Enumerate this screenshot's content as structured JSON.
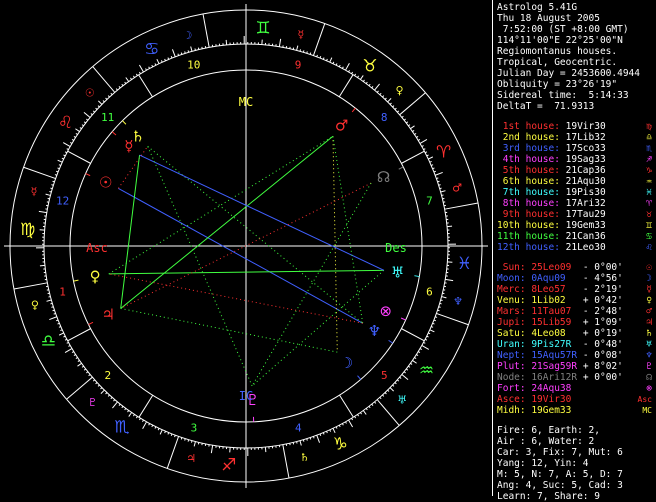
{
  "header": [
    "Astrolog 5.41G",
    "Thu 18 August 2005",
    " 7:52:00 (ST +8:00 GMT)",
    "114°11'00\"E 22°25'00\"N",
    "Regiomontanus houses.",
    "Tropical, Geocentric.",
    "Julian Day = 2453600.4944",
    "Obliquity = 23°26'19\"",
    "Sidereal time:  5:14:33",
    "DeltaT =  71.9313"
  ],
  "houses": [
    {
      "label": "1st house:",
      "value": "19Vir30",
      "color": "#ff3030",
      "glyph": "♍"
    },
    {
      "label": "2nd house:",
      "value": "17Lib32",
      "color": "#ffff40",
      "glyph": "♎"
    },
    {
      "label": "3rd house:",
      "value": "17Sco33",
      "color": "#4060ff",
      "glyph": "♏"
    },
    {
      "label": "4th house:",
      "value": "19Sag33",
      "color": "#ff40ff",
      "glyph": "♐"
    },
    {
      "label": "5th house:",
      "value": "21Cap36",
      "color": "#ff3030",
      "glyph": "♑"
    },
    {
      "label": "6th house:",
      "value": "21Aqu30",
      "color": "#ffff40",
      "glyph": "♒"
    },
    {
      "label": "7th house:",
      "value": "19Pis30",
      "color": "#40ffff",
      "glyph": "♓"
    },
    {
      "label": "8th house:",
      "value": "17Ari32",
      "color": "#ff40ff",
      "glyph": "♈"
    },
    {
      "label": "9th house:",
      "value": "17Tau29",
      "color": "#ff3030",
      "glyph": "♉"
    },
    {
      "label": "10th house:",
      "value": "19Gem33",
      "color": "#ffff40",
      "glyph": "♊"
    },
    {
      "label": "11th house:",
      "value": "21Can36",
      "color": "#40ff40",
      "glyph": "♋"
    },
    {
      "label": "12th house:",
      "value": "21Leo30",
      "color": "#4060ff",
      "glyph": "♌"
    }
  ],
  "planets": [
    {
      "name": "Sun:",
      "pos": "25Leo09",
      "motion": "- 0°00'",
      "color": "#ff3030",
      "glyph": "☉"
    },
    {
      "name": "Moon:",
      "pos": "0Aqu09",
      "motion": "- 4°56'",
      "color": "#4060ff",
      "glyph": "☽"
    },
    {
      "name": "Merc:",
      "pos": "8Leo57",
      "motion": "- 2°19'",
      "color": "#ff3030",
      "glyph": "☿"
    },
    {
      "name": "Venu:",
      "pos": "1Lib02",
      "motion": "+ 0°42'",
      "color": "#ffff40",
      "glyph": "♀"
    },
    {
      "name": "Mars:",
      "pos": "11Tau07",
      "motion": "- 2°48'",
      "color": "#ff3030",
      "glyph": "♂"
    },
    {
      "name": "Jupi:",
      "pos": "15Lib59",
      "motion": "+ 1°09'",
      "color": "#ff3030",
      "glyph": "♃"
    },
    {
      "name": "Satu:",
      "pos": "4Leo08",
      "motion": "+ 0°19'",
      "color": "#ffff40",
      "glyph": "♄"
    },
    {
      "name": "Uran:",
      "pos": "9Pis27R",
      "motion": "- 0°48'",
      "color": "#40ffff",
      "glyph": "♅"
    },
    {
      "name": "Nept:",
      "pos": "15Aqu57R",
      "motion": "- 0°08'",
      "color": "#4060ff",
      "glyph": "♆"
    },
    {
      "name": "Plut:",
      "pos": "21Sag59R",
      "motion": "+ 8°02'",
      "color": "#ff40ff",
      "glyph": "♇"
    },
    {
      "name": "Node:",
      "pos": "16Ari12R",
      "motion": "+ 0°00'",
      "color": "#808080",
      "glyph": "☊"
    },
    {
      "name": "Fort:",
      "pos": "24Aqu38",
      "motion": "",
      "color": "#ff40ff",
      "glyph": "⊗"
    },
    {
      "name": "Asce:",
      "pos": "19Vir30",
      "motion": "",
      "color": "#ff3030",
      "glyph": "Asc"
    },
    {
      "name": "Midh:",
      "pos": "19Gem33",
      "motion": "",
      "color": "#ffff40",
      "glyph": "MC"
    }
  ],
  "summary": [
    "Fire: 6, Earth: 2,",
    "Air : 6, Water: 2",
    "Car: 3, Fix: 7, Mut: 6",
    "Yang: 12, Yin: 4",
    "M: 5, N: 7, A: 5, D: 7",
    "Ang: 4, Suc: 5, Cad: 3",
    "Learn: 7, Share: 9"
  ],
  "wheel": {
    "asc_label": "Asc",
    "des_label": "Des",
    "mc_label": "MC",
    "ic_label": "IC",
    "signs": [
      {
        "glyph": "♈",
        "color": "#ff3030"
      },
      {
        "glyph": "♉",
        "color": "#ffff40"
      },
      {
        "glyph": "♊",
        "color": "#40ff40"
      },
      {
        "glyph": "♋",
        "color": "#4060ff"
      },
      {
        "glyph": "♌",
        "color": "#ff3030"
      },
      {
        "glyph": "♍",
        "color": "#ffff40"
      },
      {
        "glyph": "♎",
        "color": "#40ff40"
      },
      {
        "glyph": "♏",
        "color": "#4060ff"
      },
      {
        "glyph": "♐",
        "color": "#ff3030"
      },
      {
        "glyph": "♑",
        "color": "#ffff40"
      },
      {
        "glyph": "♒",
        "color": "#40ff40"
      },
      {
        "glyph": "♓",
        "color": "#4060ff"
      }
    ],
    "rulers": [
      "♂",
      "♀",
      "☿",
      "☽",
      "☉",
      "☿",
      "♀",
      "♇",
      "♃",
      "♄",
      "♅",
      "♆"
    ],
    "ruler_colors": [
      "#ff3030",
      "#ffff40",
      "#ff3030",
      "#4060ff",
      "#ff3030",
      "#ff3030",
      "#ffff40",
      "#ff40ff",
      "#ff3030",
      "#ffff40",
      "#40ffff",
      "#4060ff"
    ],
    "house_numbers": [
      "1",
      "2",
      "3",
      "4",
      "5",
      "6",
      "7",
      "8",
      "9",
      "10",
      "11",
      "12"
    ],
    "house_number_colors": [
      "#ff3030",
      "#ffff40",
      "#40ff40",
      "#4060ff",
      "#ff3030",
      "#ffff40",
      "#40ff40",
      "#4060ff",
      "#ff3030",
      "#ffff40",
      "#40ff40",
      "#4060ff"
    ]
  }
}
